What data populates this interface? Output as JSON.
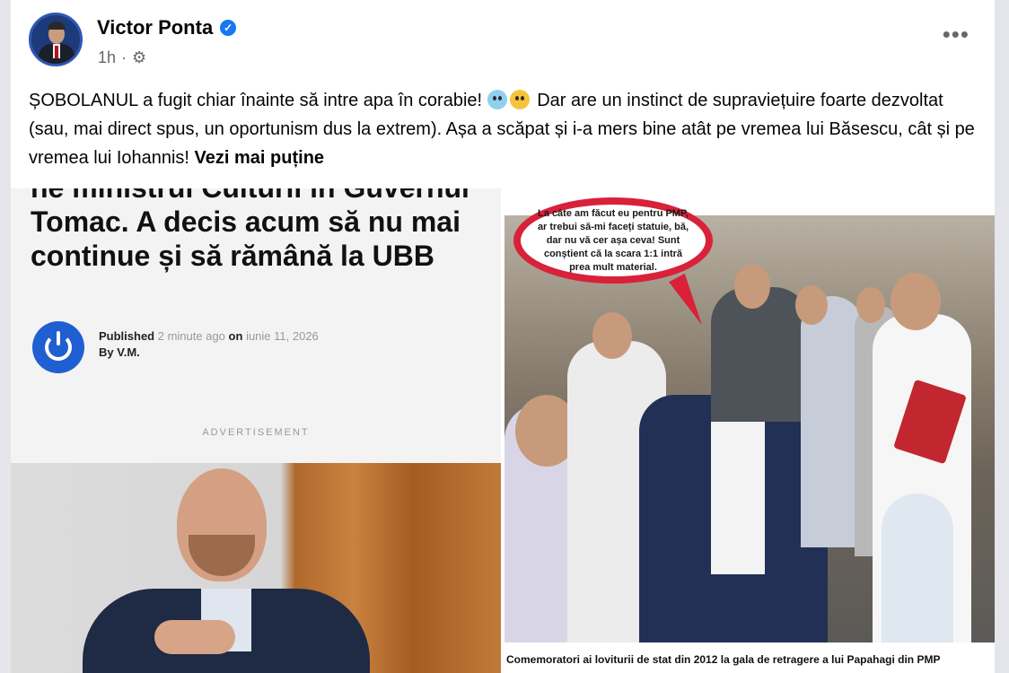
{
  "post": {
    "author": "Victor Ponta",
    "time": "1h",
    "text_1": "ȘOBOLANUL a fugit chiar înainte să intre apa în corabie!",
    "text_2": "Dar are un instinct de supraviețuire foarte dezvoltat (sau, mai direct spus, un oportunism dus la extrem). Așa a scăpat și i-a mers bine atât pe vremea lui Băsescu, cât și pe vremea lui Iohannis!",
    "see_less": "Vezi mai puține",
    "more_label": "•••"
  },
  "icons": {
    "verified": "verified-badge-icon",
    "privacy": "gear-icon",
    "more": "more-options-icon"
  },
  "left_article": {
    "headline": "ne ministrul Culturii în Guvernul Tomac. A decis acum să nu mai continue și să rămână la UBB",
    "published_label": "Published",
    "published_ago": "2 minute ago",
    "on_label": "on",
    "date": "iunie 11, 2026",
    "byline": "By V.M.",
    "ad_label": "ADVERTISEMENT"
  },
  "right_image": {
    "speech_bubble": "La câte am făcut eu pentru PMP, ar trebui să-mi faceți statuie, bă, dar nu vă cer așa ceva! Sunt conștient că la scara 1:1 intră prea mult material.",
    "caption": "Comemoratori ai loviturii de stat din 2012 la gala de retragere a lui Papahagi din PMP"
  },
  "colors": {
    "verified_blue": "#1877f2",
    "bubble_red": "#d9213a",
    "text_dark": "#050505",
    "text_muted": "#65676b"
  }
}
